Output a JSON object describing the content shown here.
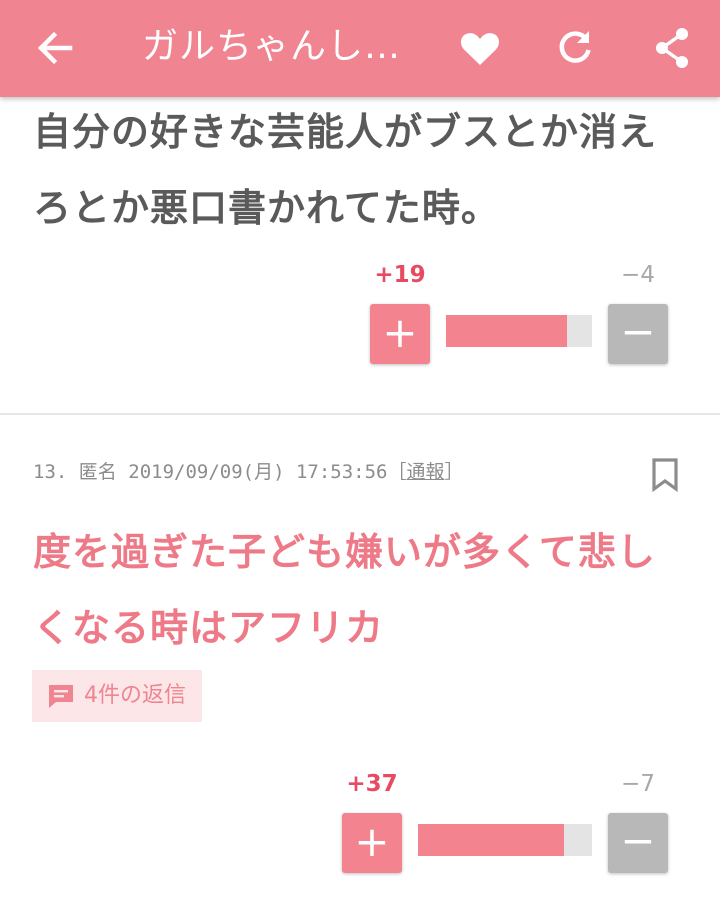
{
  "app_bar": {
    "title": "ガルちゃんし…"
  },
  "comment_prev": {
    "text_line1": "自分の好きな芸能人がブスとか消え",
    "text_line2": "ろとか悪口書かれてた時。",
    "plus_count": "+19",
    "minus_count": "−4",
    "plus_symbol": "+",
    "minus_symbol": "−",
    "plus_ratio": 0.83
  },
  "comment_13": {
    "number": "13.",
    "author": "匿名",
    "date": "2019/09/09(月) 17:53:56",
    "report_open": "［",
    "report_label": "通報",
    "report_close": "］",
    "text_line1": "度を過ぎた子ども嫌いが多くて悲し",
    "text_line2": "くなる時はアフリカ",
    "replies_label": "4件の返信",
    "plus_count": "+37",
    "minus_count": "−7",
    "plus_symbol": "+",
    "minus_symbol": "−",
    "plus_ratio": 0.84
  },
  "colors": {
    "accent": "#f08491",
    "plus_red": "#e64b62",
    "pink_text": "#ee7a88",
    "minus_gray": "#b8b8b8"
  },
  "icons": {
    "back": "arrow-left-icon",
    "favorite": "heart-icon",
    "refresh": "refresh-icon",
    "share": "share-icon",
    "bookmark": "bookmark-icon",
    "replies": "comment-icon"
  }
}
